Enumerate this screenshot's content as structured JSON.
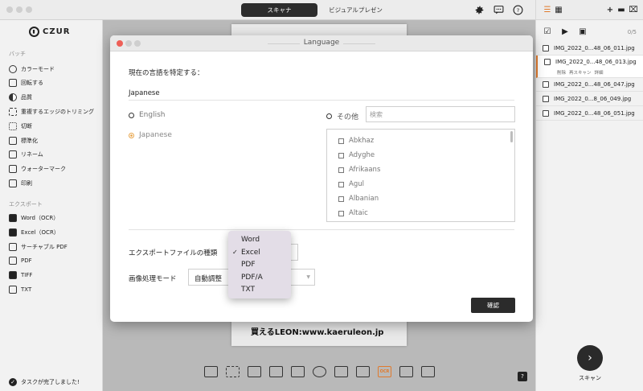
{
  "topbar": {
    "tabs": [
      {
        "label": "スキャナ",
        "active": true
      },
      {
        "label": "ビジュアルプレゼン",
        "active": false
      }
    ],
    "icons": [
      "gear-icon",
      "chat-icon",
      "help-icon"
    ]
  },
  "sidebar": {
    "logo": "CZUR",
    "batch_section": "バッチ",
    "batch_items": [
      {
        "label": "カラーモード",
        "icon": "palette-icon"
      },
      {
        "label": "回転する",
        "icon": "rotate-icon"
      },
      {
        "label": "品質",
        "icon": "quality-icon"
      },
      {
        "label": "重複するエッジのトリミング",
        "icon": "edge-trim-icon"
      },
      {
        "label": "切断",
        "icon": "cut-icon"
      },
      {
        "label": "標準化",
        "icon": "standardize-icon"
      },
      {
        "label": "リネーム",
        "icon": "rename-icon"
      },
      {
        "label": "ウォーターマーク",
        "icon": "watermark-icon"
      },
      {
        "label": "印刷",
        "icon": "print-icon"
      }
    ],
    "export_section": "エクスポート",
    "export_items": [
      {
        "label": "Word（OCR）",
        "icon": "word-icon"
      },
      {
        "label": "Excel（OCR）",
        "icon": "excel-icon"
      },
      {
        "label": "サーチャブル PDF",
        "icon": "searchable-pdf-icon"
      },
      {
        "label": "PDF",
        "icon": "pdf-icon"
      },
      {
        "label": "TIFF",
        "icon": "tiff-icon"
      },
      {
        "label": "TXT",
        "icon": "txt-icon"
      }
    ],
    "status": "タスクが完了しました!"
  },
  "canvas": {
    "document_text": "買えるLEON:www.kaeruleon.jp"
  },
  "right_panel": {
    "count": "0/5",
    "files": [
      {
        "name": "IMG_2022_0...48_06_011.jpg",
        "selected": false
      },
      {
        "name": "IMG_2022_0...48_06_013.jpg",
        "selected": true
      },
      {
        "name": "IMG_2022_0...48_06_047.jpg",
        "selected": false
      },
      {
        "name": "IMG_2022_0...8_06_049.jpg",
        "selected": false
      },
      {
        "name": "IMG_2022_0...48_06_051.jpg",
        "selected": false
      }
    ],
    "file_actions": [
      "削除",
      "再スキャン",
      "詳細"
    ],
    "scan_label": "スキャン"
  },
  "dialog": {
    "title": "Language",
    "prompt": "現在の言語を特定する：",
    "current_language": "Japanese",
    "options": {
      "english": "English",
      "japanese": "Japanese",
      "other": "その他"
    },
    "search_placeholder": "検索",
    "languages": [
      "Abkhaz",
      "Adyghe",
      "Afrikaans",
      "Agul",
      "Albanian",
      "Altaic"
    ],
    "export_type_label": "エクスポートファイルの種類",
    "image_mode_label": "画像処理モード",
    "image_mode_value": "自動調整",
    "confirm_label": "確認",
    "export_type_options": [
      "Word",
      "Excel",
      "PDF",
      "PDF/A",
      "TXT"
    ],
    "export_type_selected": "Excel",
    "check_glyph": "✓"
  },
  "colors": {
    "accent": "#e07a2d",
    "dark_button": "#2b2b2b"
  }
}
